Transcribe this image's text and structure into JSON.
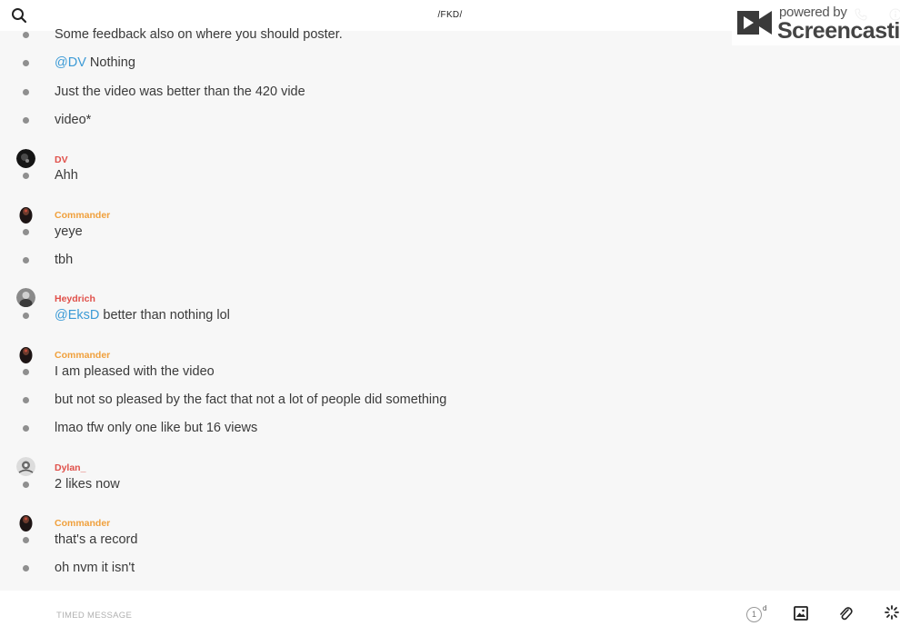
{
  "header": {
    "channel_name": "/FKD/",
    "search_icon": "search-icon",
    "phone_icon": "phone-icon",
    "info_icon": "info-icon"
  },
  "watermark": {
    "line1": "powered by",
    "line2": "Screencastify"
  },
  "colors": {
    "mention": "#3d9bd6",
    "author_orange": "#f0a03c",
    "author_red": "#e0504a",
    "bullet": "#8f8f8f"
  },
  "messages": [
    {
      "text": "Some feedback also on where you should poster."
    },
    {
      "mention": "@DV",
      "text": " Nothing"
    },
    {
      "text": "Just the video was better than the 420 vide"
    },
    {
      "text": "video*"
    },
    {
      "author": "DV",
      "text": "Ahh"
    },
    {
      "author": "Commander",
      "text": "yeye"
    },
    {
      "text": "tbh"
    },
    {
      "author": "Heydrich",
      "mention": "@EksD",
      "text": " better than nothing lol"
    },
    {
      "author": "Commander",
      "text": "I am pleased with the video"
    },
    {
      "text": "but not so pleased by the fact that not a lot of people did something"
    },
    {
      "text": "lmao tfw only one like but 16 views"
    },
    {
      "author": "Dylan_",
      "text": "2 likes now"
    },
    {
      "author": "Commander",
      "text": "that's a record"
    },
    {
      "text": "oh nvm it isn't"
    }
  ],
  "authors": {
    "dv": "DV",
    "commander": "Commander",
    "heydrich": "Heydrich",
    "dylan": "Dylan_"
  },
  "composer": {
    "placeholder": "TIMED MESSAGE",
    "timer_value": "1",
    "timer_unit": "d",
    "image_icon": "image-icon",
    "attach_icon": "paperclip-icon",
    "spinner_icon": "loading-spinner-icon"
  }
}
